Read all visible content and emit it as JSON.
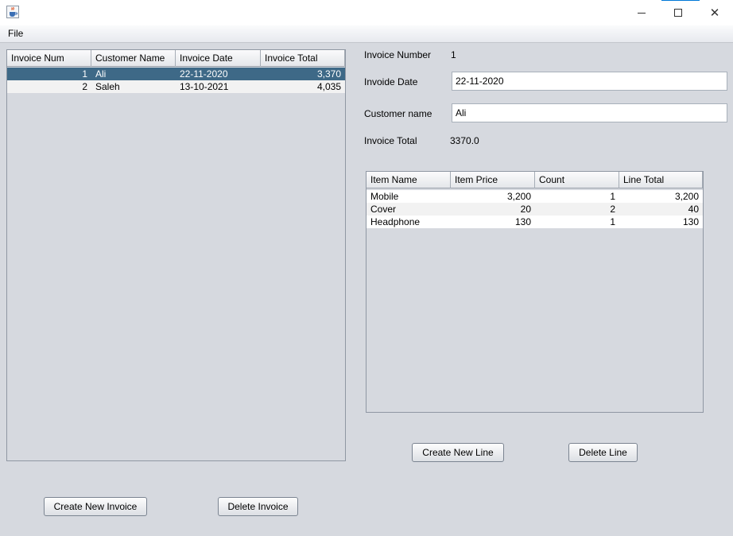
{
  "window": {
    "icon": "java-cup-icon",
    "controls": {
      "minimize": "minimize-icon",
      "maximize": "maximize-icon",
      "close": "close-icon",
      "close_glyph": "✕"
    }
  },
  "menu": {
    "file": "File"
  },
  "invoices_table": {
    "columns": [
      "Invoice Num",
      "Customer Name",
      "Invoice Date",
      "Invoice Total"
    ],
    "rows": [
      [
        "1",
        "Ali",
        "22-11-2020",
        "3,370"
      ],
      [
        "2",
        "Saleh",
        "13-10-2021",
        "4,035"
      ]
    ],
    "selected_row": 0
  },
  "details": {
    "invoice_number_label": "Invoice Number",
    "invoice_number_value": "1",
    "invoice_date_label": "Invoide Date",
    "invoice_date_value": "22-11-2020",
    "customer_name_label": "Customer name",
    "customer_name_value": "Ali",
    "invoice_total_label": "Invoice Total",
    "invoice_total_value": "3370.0"
  },
  "lines_table": {
    "columns": [
      "Item Name",
      "Item Price",
      "Count",
      "Line Total"
    ],
    "rows": [
      [
        "Mobile",
        "3,200",
        "1",
        "3,200"
      ],
      [
        "Cover",
        "20",
        "2",
        "40"
      ],
      [
        "Headphone",
        "130",
        "1",
        "130"
      ]
    ]
  },
  "buttons": {
    "create_invoice": "Create New Invoice",
    "delete_invoice": "Delete Invoice",
    "create_line": "Create New Line",
    "delete_line": "Delete Line"
  },
  "colors": {
    "window_bg": "#d6d9df",
    "selection": "#3e6987",
    "accent": "#0078d7"
  }
}
